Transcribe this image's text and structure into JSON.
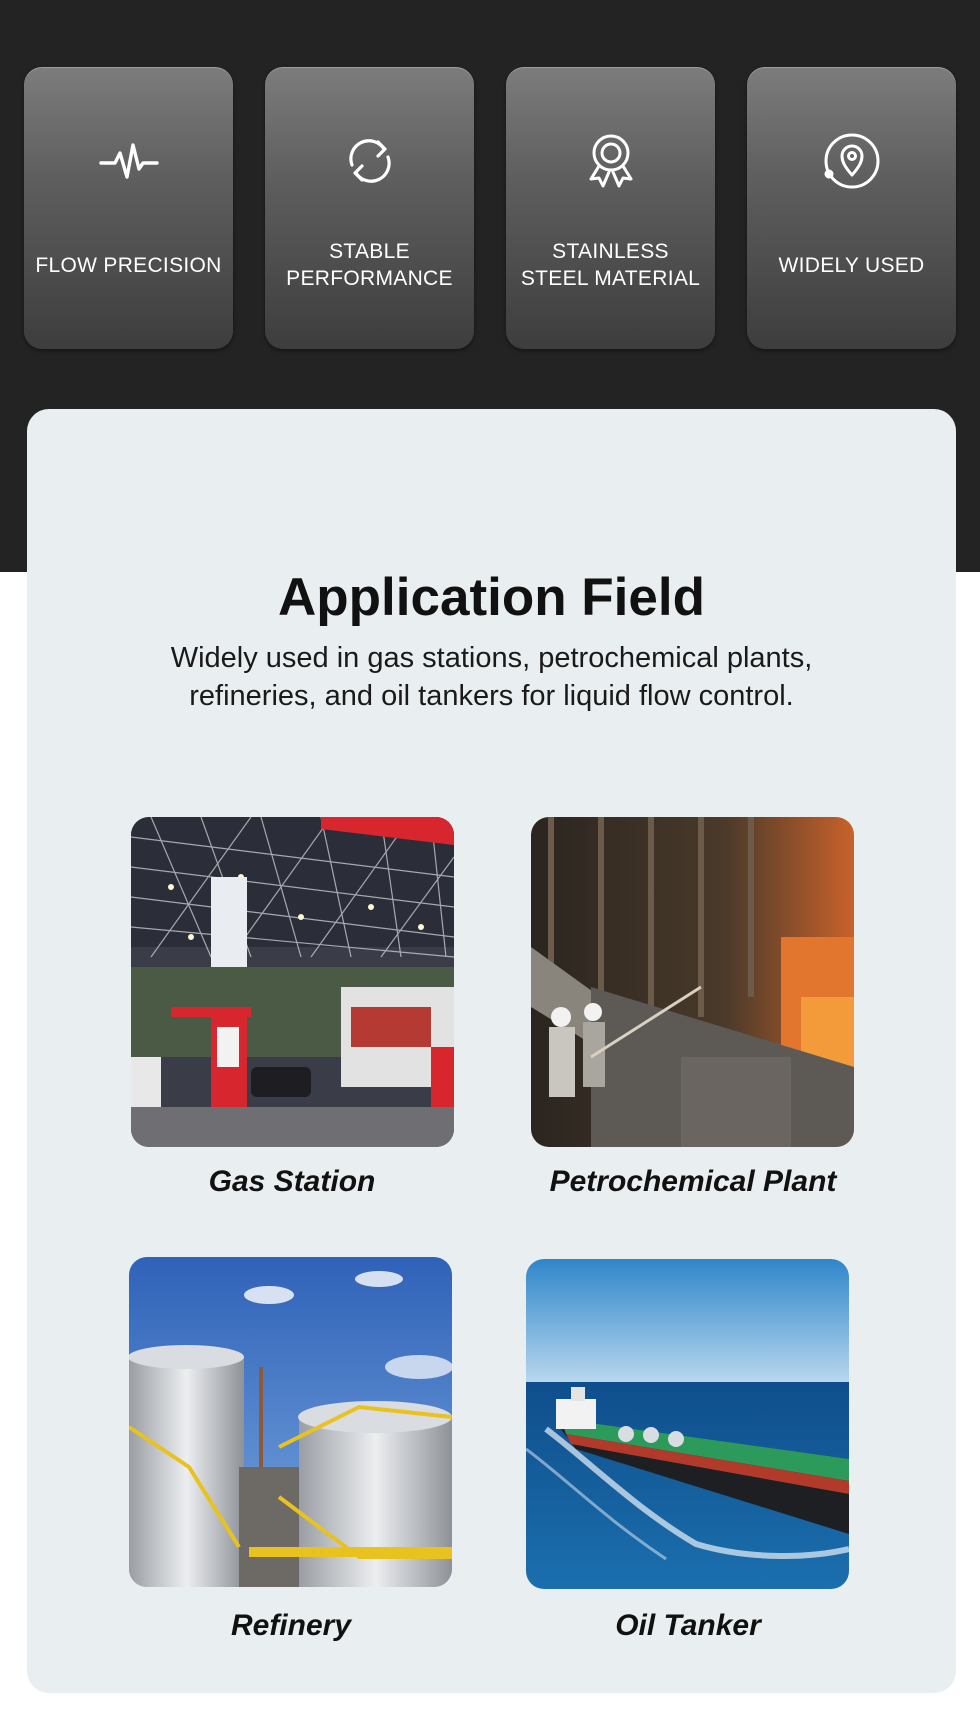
{
  "features": [
    {
      "label": "FLOW PRECISION",
      "icon": "pulse-icon"
    },
    {
      "label": "STABLE\nPERFORMANCE",
      "icon": "refresh-cycle-icon"
    },
    {
      "label": "STAINLESS\nSTEEL MATERIAL",
      "icon": "award-badge-icon"
    },
    {
      "label": "WIDELY USED",
      "icon": "location-pin-icon"
    }
  ],
  "application": {
    "title": "Application Field",
    "subtitle": "Widely used in gas stations, petrochemical plants,\nrefineries, and oil tankers for liquid flow control.",
    "items": [
      {
        "caption": "Gas Station",
        "photo": "gas-station-photo"
      },
      {
        "caption": "Petrochemical Plant",
        "photo": "petrochemical-plant-photo"
      },
      {
        "caption": "Refinery",
        "photo": "refinery-photo"
      },
      {
        "caption": "Oil Tanker",
        "photo": "oil-tanker-photo"
      }
    ]
  },
  "colors": {
    "background_dark": "#232323",
    "panel": "#e9eff1",
    "card_top": "#7c7c7c",
    "card_bottom": "#3d3d3d",
    "text_dark": "#111111"
  }
}
